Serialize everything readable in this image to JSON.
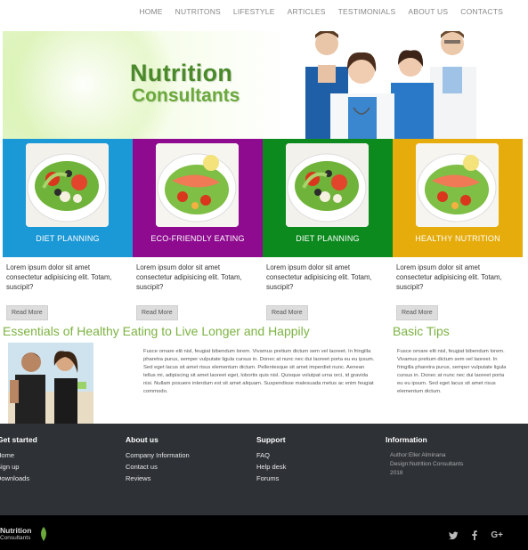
{
  "nav": {
    "items": [
      "HOME",
      "NUTRITONS",
      "LIFESTYLE",
      "ARTICLES",
      "TESTIMONIALS",
      "ABOUT US",
      "CONTACTS"
    ]
  },
  "hero": {
    "title_line1": "Nutrition",
    "title_line2": "Consultants"
  },
  "tiles": [
    {
      "label": "DIET PLANNING",
      "color": "#1b98d6"
    },
    {
      "label": "ECO-FRIENDLY EATING",
      "color": "#8e0a8f"
    },
    {
      "label": "DIET PLANNING",
      "color": "#0c8a1e"
    },
    {
      "label": "HEALTHY NUTRITION",
      "color": "#e5ac0c"
    }
  ],
  "columns": [
    {
      "text": "Lorem ipsum dolor sit amet consectetur adipisicing elit. Totam, suscipit?",
      "button": "Read More"
    },
    {
      "text": "Lorem ipsum dolor sit amet consectetur adipisicing elit. Totam, suscipit?",
      "button": "Read More"
    },
    {
      "text": "Lorem ipsum dolor sit amet consectetur adipisicing elit. Totam, suscipit?",
      "button": "Read More"
    },
    {
      "text": "Lorem ipsum dolor sit amet consectetur adipisicing elit. Totam, suscipit?",
      "button": "Read More"
    }
  ],
  "essentials": {
    "title": "Essentials of Healthy Eating to Live Longer and Happily",
    "text": "Fusce ornare elit nisl, feugiat bibendum lorem. Vivamus pretium dictum sem vel laoreet. In fringilla pharetra purus, semper vulputate ligula cursus in. Donec at nunc nec dui laoreet porta eu eu ipsum. Sed eget lacus sit amet risus elementum dictum. Pellentesque sit amet imperdiet nunc. Aenean tellus mi, adipiscing sit amet laoreet eget, lobortis quis nisl. Quisque volutpat urna orci, id gravida nisi. Nullam posuere interdum est sit amet aliquam. Suspendisse malesuada metus ac enim feugiat commodo."
  },
  "basic_tips": {
    "title": "Basic Tips",
    "text": "Fusce ornare elit nisl, feugiat bibendum lorem. Vivamus pretium dictum sem vel laoreet. In fringilla pharetra purus, semper vulputate ligula cursus in. Donec at nunc nec dui laoreet porta eu eu ipsum. Sed eget lacus sit amet risus elementum dictum."
  },
  "footer": {
    "get_started": {
      "title": "Get started",
      "links": [
        "Home",
        "Sign up",
        "Downloads"
      ]
    },
    "about_us": {
      "title": "About us",
      "links": [
        "Company Information",
        "Contact us",
        "Reviews"
      ]
    },
    "support": {
      "title": "Support",
      "links": [
        "FAQ",
        "Help desk",
        "Forums"
      ]
    },
    "information": {
      "title": "Information",
      "lines": [
        "Author:Eller Alminana",
        "Design:Nutrition Consultants",
        "2018"
      ]
    }
  },
  "bottom": {
    "logo_line1": "Nutrition",
    "logo_line2": "Consultants",
    "social": [
      "twitter-icon",
      "facebook-icon",
      "google-plus-icon"
    ],
    "google_plus_label": "G+"
  }
}
